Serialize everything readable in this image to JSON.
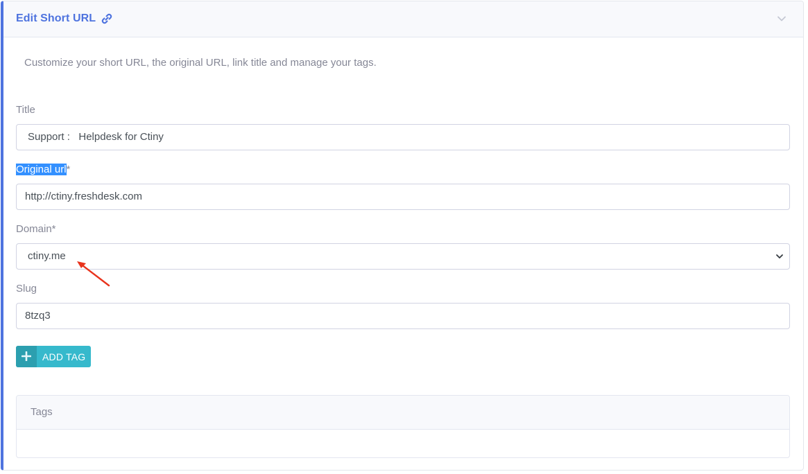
{
  "header": {
    "title": "Edit Short URL",
    "link_icon": "link-icon",
    "collapse_icon": "chevron-down-icon"
  },
  "description": "Customize your short URL, the original URL, link title and manage your tags.",
  "form": {
    "title_label": "Title",
    "title_value": "Support :   Helpdesk for Ctiny",
    "original_label_highlighted": "Original url",
    "original_label_suffix": "*",
    "original_value": "http://ctiny.freshdesk.com",
    "domain_label": "Domain*",
    "domain_value": "ctiny.me",
    "slug_label": "Slug",
    "slug_value": "8tzq3"
  },
  "add_tag": {
    "label": "ADD TAG",
    "icon": "plus-icon"
  },
  "tags": {
    "title": "Tags"
  },
  "colors": {
    "accent": "#4e73df",
    "info": "#36b9cc",
    "annotation_arrow": "#e8331c"
  }
}
